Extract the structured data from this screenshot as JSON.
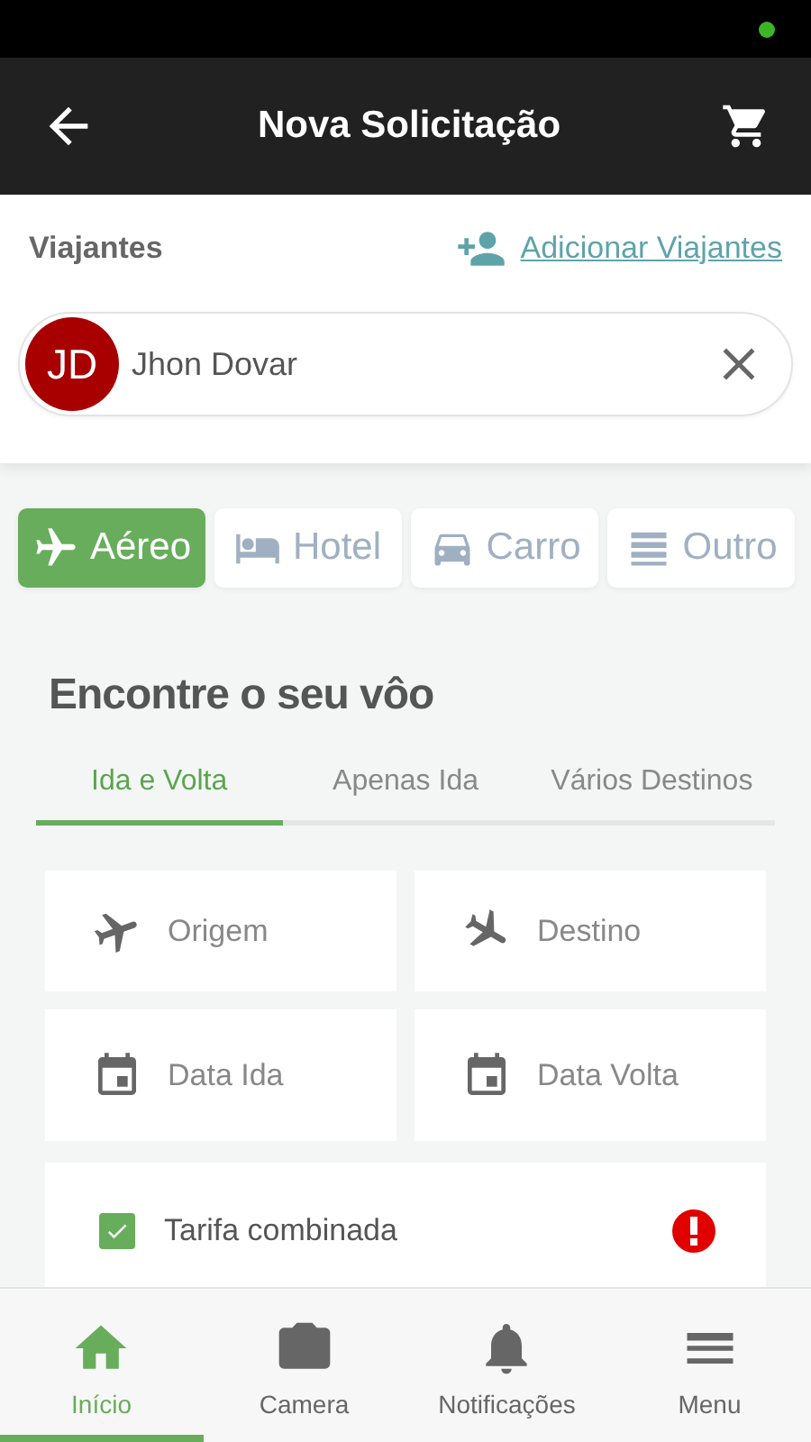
{
  "app_bar": {
    "title": "Nova Solicitação"
  },
  "travelers": {
    "label": "Viajantes",
    "add_link": "Adicionar Viajantes",
    "chips": [
      {
        "initials": "JD",
        "name": "Jhon Dovar"
      }
    ]
  },
  "categories": [
    {
      "label": "Aéreo",
      "selected": true
    },
    {
      "label": "Hotel",
      "selected": false
    },
    {
      "label": "Carro",
      "selected": false
    },
    {
      "label": "Outro",
      "selected": false
    }
  ],
  "search": {
    "heading": "Encontre o seu vôo",
    "trip_tabs": [
      {
        "label": "Ida e Volta",
        "selected": true
      },
      {
        "label": "Apenas Ida",
        "selected": false
      },
      {
        "label": "Vários Destinos",
        "selected": false
      }
    ],
    "fields": [
      {
        "placeholder": "Origem"
      },
      {
        "placeholder": "Destino"
      },
      {
        "placeholder": "Data Ida"
      },
      {
        "placeholder": "Data Volta"
      }
    ],
    "options": [
      {
        "label": "Tarifa combinada",
        "checked": true
      }
    ]
  },
  "bottom_nav": [
    {
      "label": "Início",
      "selected": true
    },
    {
      "label": "Camera",
      "selected": false
    },
    {
      "label": "Notificações",
      "selected": false
    },
    {
      "label": "Menu",
      "selected": false
    }
  ]
}
